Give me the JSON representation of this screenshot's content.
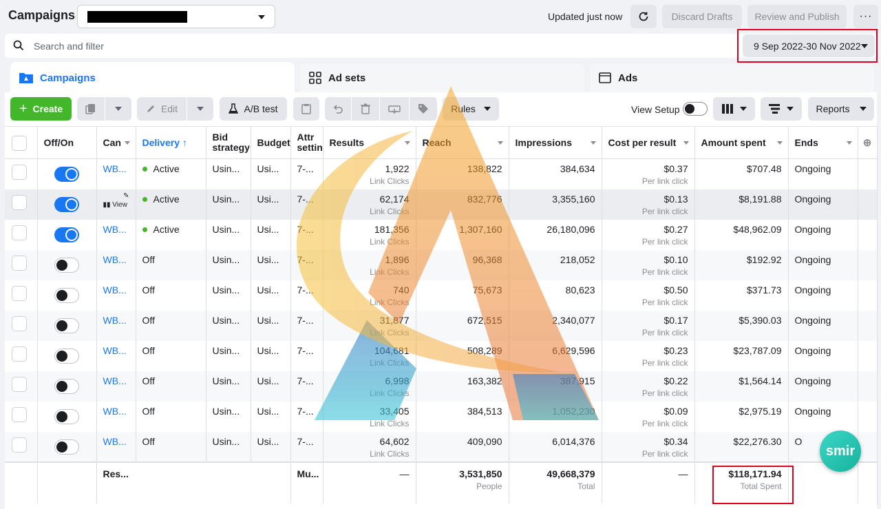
{
  "header": {
    "title": "Campaigns",
    "updated": "Updated just now",
    "discard": "Discard Drafts",
    "review": "Review and Publish",
    "more": "···"
  },
  "search": {
    "placeholder": "Search and filter"
  },
  "date_range": "9 Sep 2022-30 Nov 2022",
  "tabs": [
    {
      "label": "Campaigns",
      "icon": "folder-icon"
    },
    {
      "label": "Ad sets",
      "icon": "grid-icon"
    },
    {
      "label": "Ads",
      "icon": "ad-icon"
    }
  ],
  "toolbar": {
    "create": "Create",
    "edit": "Edit",
    "ab_test": "A/B test",
    "rules": "Rules",
    "view_setup": "View Setup",
    "reports": "Reports"
  },
  "columns": {
    "onoff": "Off/On",
    "campaign": "Can",
    "delivery": "Delivery",
    "bid": "Bid strategy",
    "budget": "Budget",
    "attr": "Attr settin",
    "results": "Results",
    "reach": "Reach",
    "impressions": "Impressions",
    "cpr": "Cost per result",
    "spent": "Amount spent",
    "ends": "Ends"
  },
  "rows": [
    {
      "name": "WB...",
      "delivery": "Active",
      "bid": "Usin...",
      "budget": "Usi...",
      "attr": "7-...",
      "results": "1,922",
      "results_sub": "Link Clicks",
      "reach": "138,822",
      "impressions": "384,634",
      "cpr": "$0.37",
      "cpr_sub": "Per link click",
      "spent": "$707.48",
      "ends": "Ongoing"
    },
    {
      "name": "View",
      "delivery": "Active",
      "bid": "Usin...",
      "budget": "Usi...",
      "attr": "7-...",
      "results": "62,174",
      "results_sub": "Link Clicks",
      "reach": "832,776",
      "impressions": "3,355,160",
      "cpr": "$0.13",
      "cpr_sub": "Per link click",
      "spent": "$8,191.88",
      "ends": "Ongoing"
    },
    {
      "name": "WB...",
      "delivery": "Active",
      "bid": "Usin...",
      "budget": "Usi...",
      "attr": "7-...",
      "results": "181,356",
      "results_sub": "Link Clicks",
      "reach": "1,307,160",
      "impressions": "26,180,096",
      "cpr": "$0.27",
      "cpr_sub": "Per link click",
      "spent": "$48,962.09",
      "ends": "Ongoing"
    },
    {
      "name": "WB...",
      "delivery": "Off",
      "bid": "Usin...",
      "budget": "Usi...",
      "attr": "7-...",
      "results": "1,896",
      "results_sub": "Link Clicks",
      "reach": "96,368",
      "impressions": "218,052",
      "cpr": "$0.10",
      "cpr_sub": "Per link click",
      "spent": "$192.92",
      "ends": "Ongoing"
    },
    {
      "name": "WB...",
      "delivery": "Off",
      "bid": "Usin...",
      "budget": "Usi...",
      "attr": "7-...",
      "results": "740",
      "results_sub": "Link Clicks",
      "reach": "75,673",
      "impressions": "80,623",
      "cpr": "$0.50",
      "cpr_sub": "Per link click",
      "spent": "$371.73",
      "ends": "Ongoing"
    },
    {
      "name": "WB...",
      "delivery": "Off",
      "bid": "Usin...",
      "budget": "Usi...",
      "attr": "7-...",
      "results": "31,877",
      "results_sub": "Link Clicks",
      "reach": "672,515",
      "impressions": "2,340,077",
      "cpr": "$0.17",
      "cpr_sub": "Per link click",
      "spent": "$5,390.03",
      "ends": "Ongoing"
    },
    {
      "name": "WB...",
      "delivery": "Off",
      "bid": "Usin...",
      "budget": "Usi...",
      "attr": "7-...",
      "results": "104,681",
      "results_sub": "Link Clicks",
      "reach": "508,289",
      "impressions": "6,629,596",
      "cpr": "$0.23",
      "cpr_sub": "Per link click",
      "spent": "$23,787.09",
      "ends": "Ongoing"
    },
    {
      "name": "WB...",
      "delivery": "Off",
      "bid": "Usin...",
      "budget": "Usi...",
      "attr": "7-...",
      "results": "6,998",
      "results_sub": "Link Clicks",
      "reach": "163,382",
      "impressions": "387,915",
      "cpr": "$0.22",
      "cpr_sub": "Per link click",
      "spent": "$1,564.14",
      "ends": "Ongoing"
    },
    {
      "name": "WB...",
      "delivery": "Off",
      "bid": "Usin...",
      "budget": "Usi...",
      "attr": "7-...",
      "results": "33,405",
      "results_sub": "Link Clicks",
      "reach": "384,513",
      "impressions": "1,052,230",
      "cpr": "$0.09",
      "cpr_sub": "Per link click",
      "spent": "$2,975.19",
      "ends": "Ongoing"
    },
    {
      "name": "WB...",
      "delivery": "Off",
      "bid": "Usin...",
      "budget": "Usi...",
      "attr": "7-...",
      "results": "64,602",
      "results_sub": "Link Clicks",
      "reach": "409,090",
      "impressions": "6,014,376",
      "cpr": "$0.34",
      "cpr_sub": "Per link click",
      "spent": "$22,276.30",
      "ends": "O"
    }
  ],
  "row_states": [
    "on",
    "on",
    "on",
    "off",
    "off",
    "off",
    "off",
    "off",
    "off",
    "off"
  ],
  "totals": {
    "label": "Res...",
    "attr": "Mu...",
    "results": "—",
    "reach": "3,531,850",
    "reach_sub": "People",
    "impressions": "49,668,379",
    "impressions_sub": "Total",
    "cpr": "—",
    "spent": "$118,171.94",
    "spent_sub": "Total Spent"
  },
  "badge": "smir",
  "colors": {
    "accent": "#1877f2",
    "create": "#42b72a",
    "highlight_box": "#e0001b"
  }
}
